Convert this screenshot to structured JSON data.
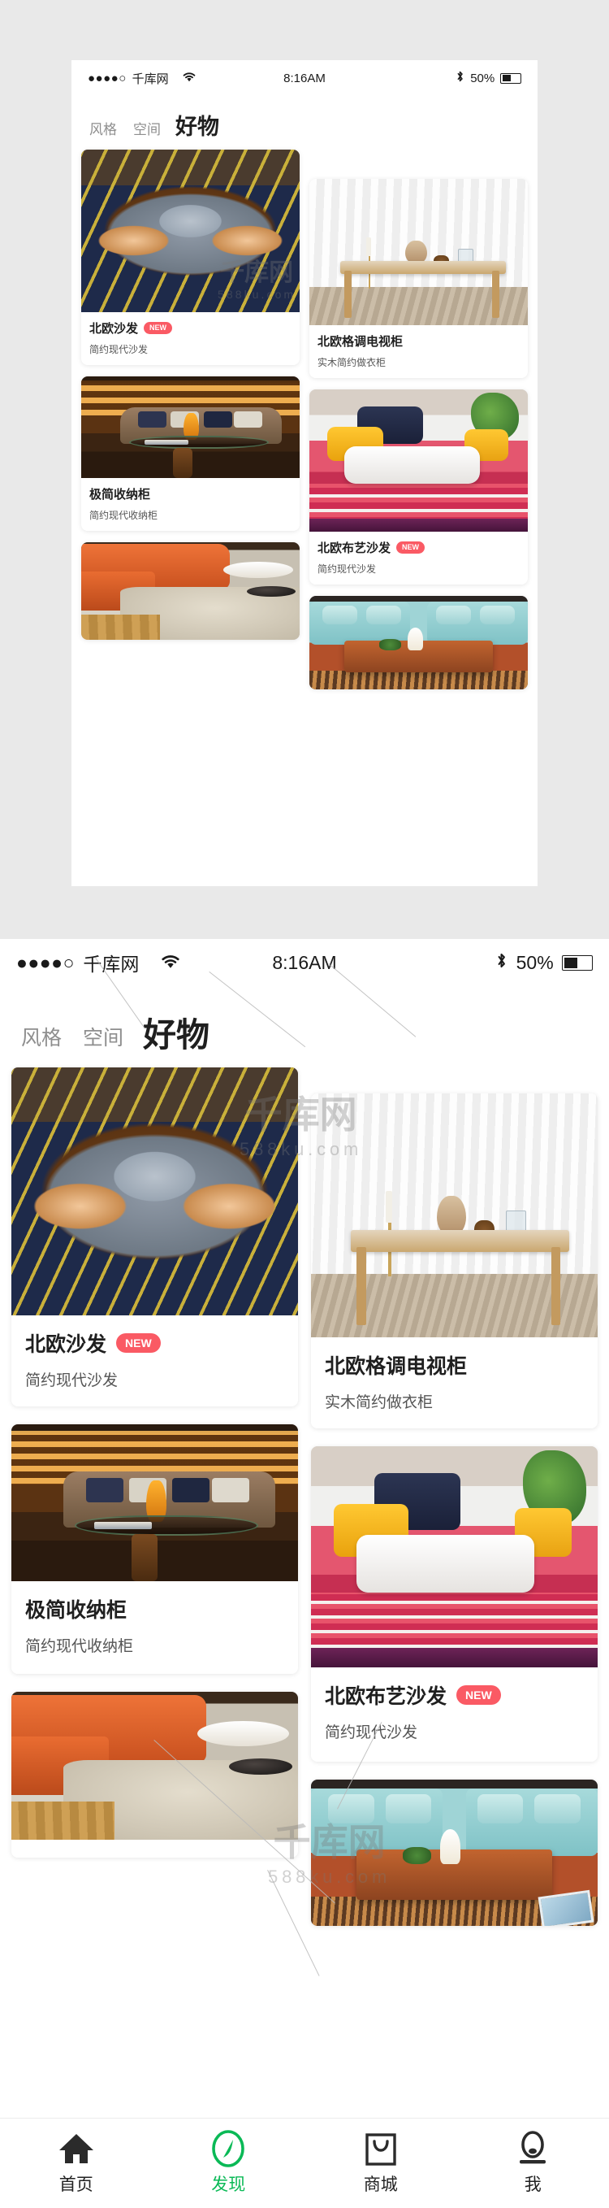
{
  "status_bar": {
    "signal_dots": "●●●●○",
    "carrier": "千库网",
    "wifi_icon": "wifi-icon",
    "time": "8:16AM",
    "bluetooth_icon": "bluetooth-icon",
    "battery_percent": "50%",
    "battery_level": 50
  },
  "nav": {
    "tabs": [
      {
        "label": "风格",
        "active": false
      },
      {
        "label": "空间",
        "active": false
      },
      {
        "label": "好物",
        "active": true
      }
    ]
  },
  "cards": {
    "left": [
      {
        "title": "北欧沙发",
        "subtitle": "简约现代沙发",
        "badge": "NEW",
        "has_badge": true,
        "image_name": "nordic-sofa-photo"
      },
      {
        "title": "极简收纳柜",
        "subtitle": "简约现代收纳柜",
        "badge": "",
        "has_badge": false,
        "image_name": "minimal-storage-cabinet-photo"
      },
      {
        "title": "",
        "subtitle": "",
        "badge": "",
        "has_badge": false,
        "image_name": "orange-sectional-sofa-photo"
      }
    ],
    "right": [
      {
        "title": "北欧格调电视柜",
        "subtitle": "实木简约做衣柜",
        "badge": "",
        "has_badge": false,
        "image_name": "nordic-tv-cabinet-photo"
      },
      {
        "title": "北欧布艺沙发",
        "subtitle": "简约现代沙发",
        "badge": "NEW",
        "has_badge": true,
        "image_name": "nordic-fabric-sofa-photo"
      },
      {
        "title": "",
        "subtitle": "",
        "badge": "",
        "has_badge": false,
        "image_name": "teal-sofa-set-photo"
      }
    ]
  },
  "tabbar": {
    "items": [
      {
        "label": "首页",
        "icon": "home-icon",
        "active": false
      },
      {
        "label": "发现",
        "icon": "compass-icon",
        "active": true
      },
      {
        "label": "商城",
        "icon": "shopping-bag-icon",
        "active": false
      },
      {
        "label": "我",
        "icon": "person-icon",
        "active": false
      }
    ]
  },
  "watermark": {
    "line1": "千库网",
    "line2": "588ku.com"
  },
  "colors": {
    "accent_green": "#0ab956",
    "badge_pink": "#fa5a64",
    "page_background": "#e9e9e9",
    "text_primary": "#1f1f1f",
    "text_secondary": "#555555",
    "tab_inactive": "#8e8e8e"
  }
}
